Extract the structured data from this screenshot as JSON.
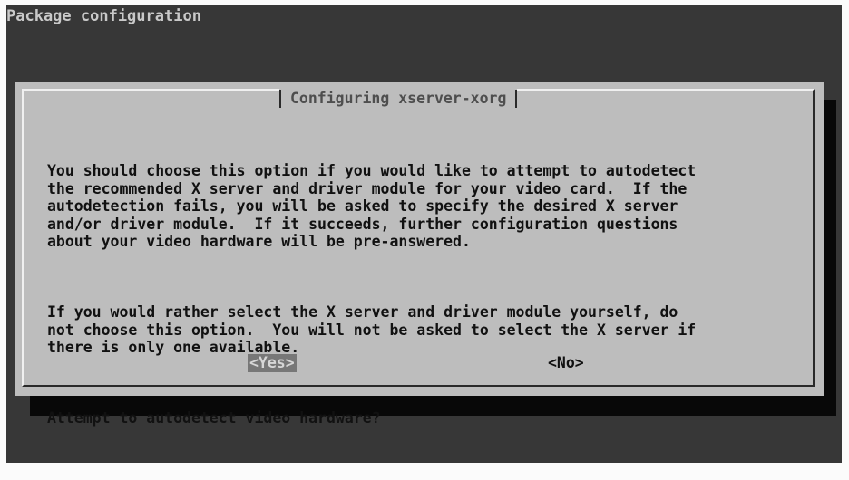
{
  "screen": {
    "title": "Package configuration"
  },
  "dialog": {
    "title": "Configuring xserver-xorg",
    "paragraphs": [
      "You should choose this option if you would like to attempt to autodetect\nthe recommended X server and driver module for your video card.  If the\nautodetection fails, you will be asked to specify the desired X server\nand/or driver module.  If it succeeds, further configuration questions\nabout your video hardware will be pre-answered.",
      "If you would rather select the X server and driver module yourself, do\nnot choose this option.  You will not be asked to select the X server if\nthere is only one available.",
      "Attempt to autodetect video hardware?"
    ],
    "buttons": {
      "yes_label": "<Yes>",
      "no_label": "<No>",
      "selected": "yes"
    }
  },
  "colors": {
    "screen_bg": "#373737",
    "dialog_bg": "#bdbdbd",
    "selected_button_bg": "#777777"
  }
}
